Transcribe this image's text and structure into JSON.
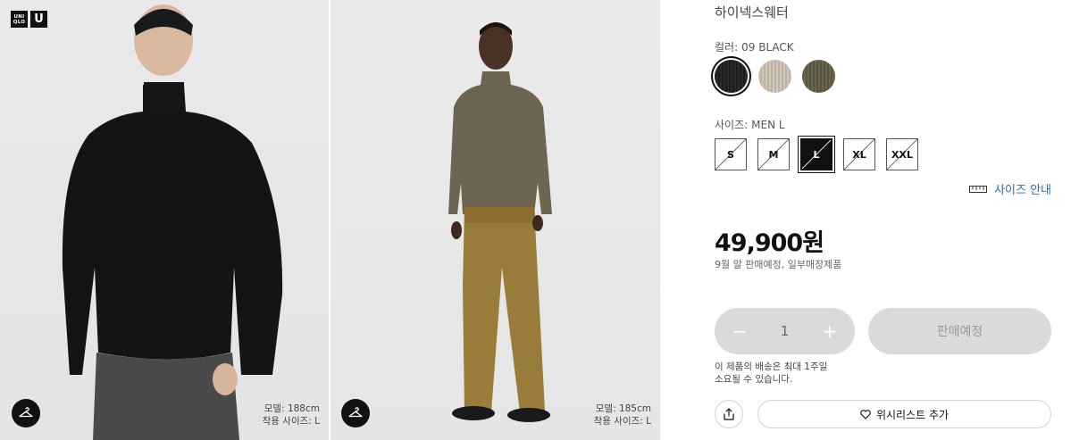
{
  "brand": {
    "logo_line1": "UNI",
    "logo_line2": "QLO",
    "logo_u": "U"
  },
  "photos": [
    {
      "model_height": "모델: 188cm",
      "model_size": "착용 사이즈: L",
      "hanger_icon": "hanger-icon"
    },
    {
      "model_height": "모델: 185cm",
      "model_size": "착용 사이즈: L",
      "hanger_icon": "hanger-icon"
    }
  ],
  "product": {
    "name": "하이넥스웨터",
    "color_label": "컬러:",
    "color_value": "09 BLACK",
    "colors": [
      {
        "name": "black",
        "hex": "#1c1c1c",
        "selected": true
      },
      {
        "name": "beige",
        "hex": "#cfc6b8",
        "selected": false
      },
      {
        "name": "olive",
        "hex": "#5e5843",
        "selected": false
      }
    ],
    "size_label": "사이즈:",
    "size_value": "MEN L",
    "sizes": [
      {
        "label": "S",
        "selected": false
      },
      {
        "label": "M",
        "selected": false
      },
      {
        "label": "L",
        "selected": true
      },
      {
        "label": "XL",
        "selected": false
      },
      {
        "label": "XXL",
        "selected": false
      }
    ],
    "size_guide_label": "사이즈 안내",
    "size_guide_icon": "ruler-icon",
    "price": "49,900원",
    "sale_note": "9월 말 판매예정,  일부매장제품"
  },
  "purchase": {
    "quantity": "1",
    "minus_symbol": "−",
    "plus_symbol": "+",
    "buy_label": "판매예정",
    "shipping_line1": "이 제품의 배송은 최대 1주일",
    "shipping_line2": "소요될 수 있습니다.",
    "share_icon": "share-icon",
    "wishlist_label": "위시리스트 추가",
    "wishlist_icon": "heart-icon"
  },
  "colors": {
    "accent_link": "#2c6fa8",
    "disabled_bg": "#dadada",
    "text": "#1b1b1b"
  }
}
